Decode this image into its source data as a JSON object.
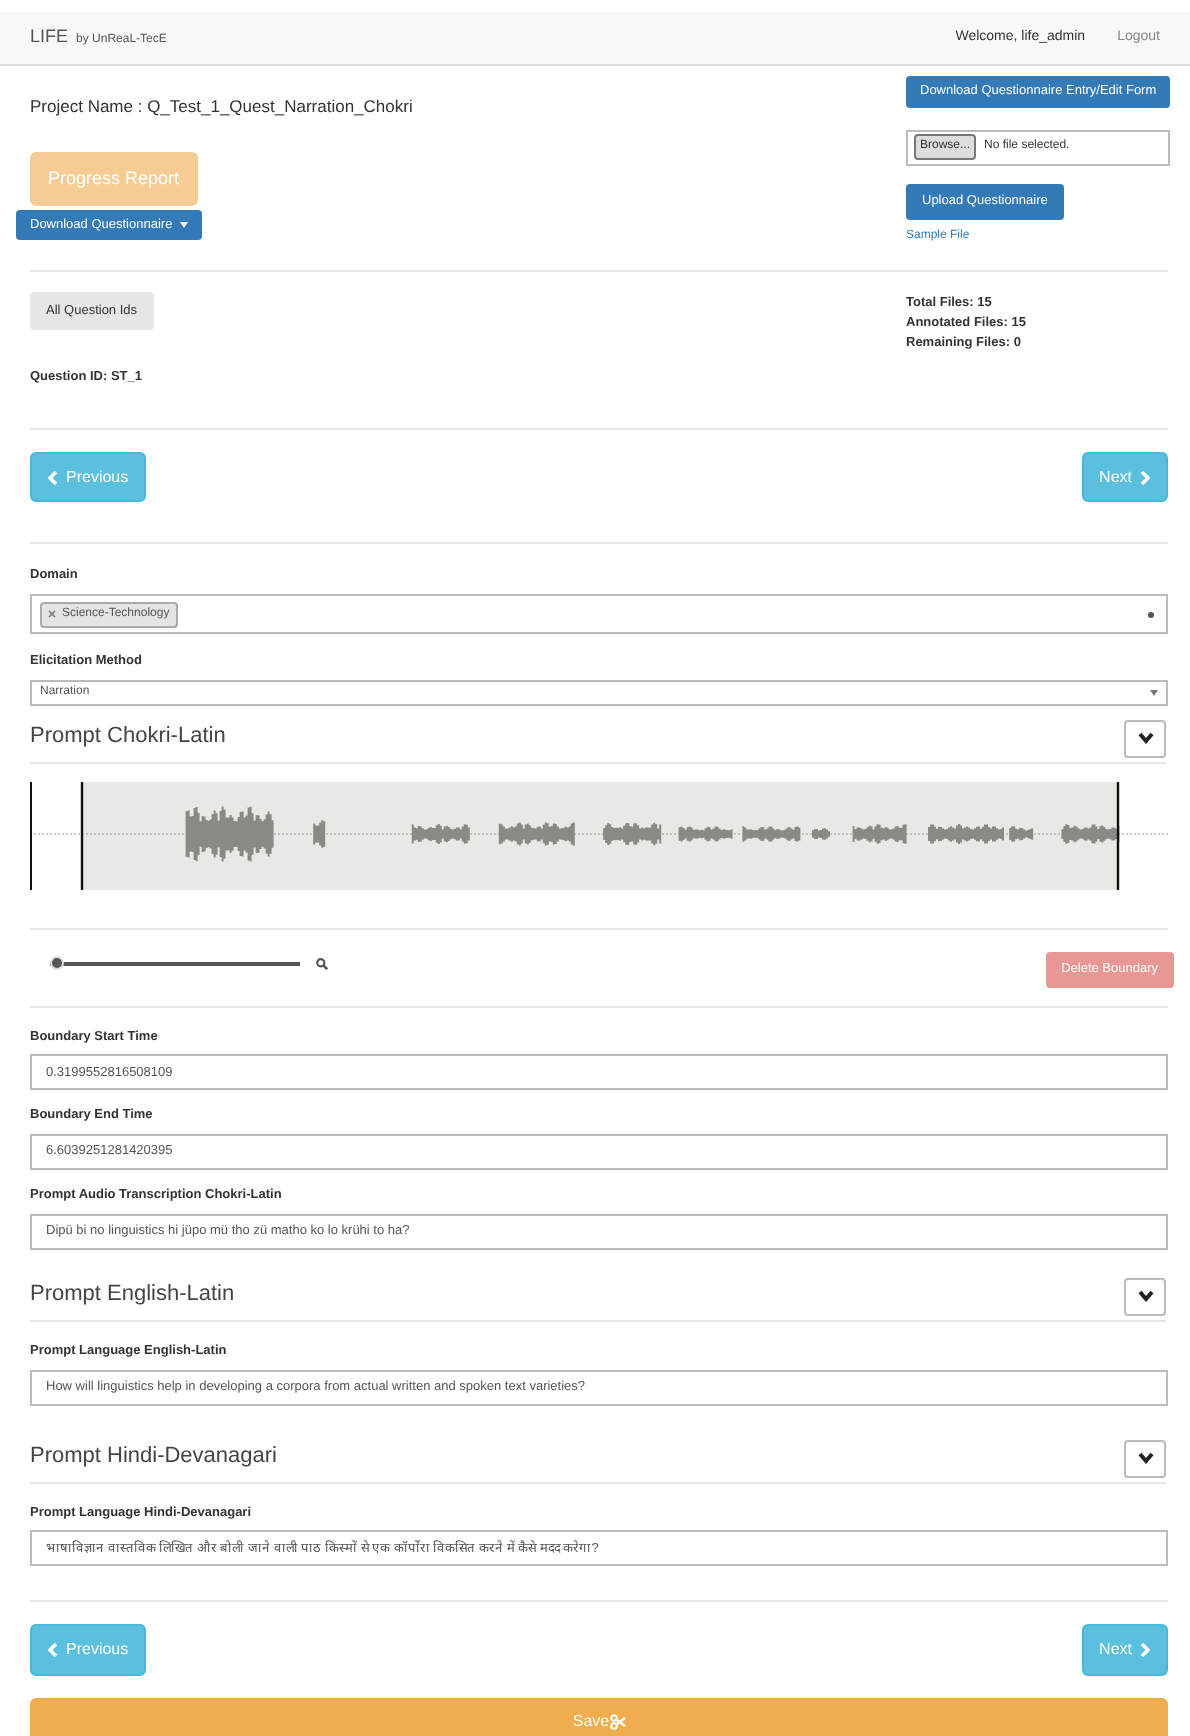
{
  "navbar": {
    "brand": "LIFE",
    "brand_sub": "by UnReaL-TecE",
    "welcome": "Welcome, life_admin",
    "logout": "Logout"
  },
  "project_name": "Project Name : Q_Test_1_Quest_Narration_Chokri",
  "download_form_button": "Download Questionnaire Entry/Edit Form",
  "progress_report_button": {
    "label": "Progress Report",
    "disabled": true
  },
  "file_input": {
    "button": "Browse...",
    "status": "No file selected."
  },
  "download_questionnaire_dropdown": "Download Questionnaire",
  "upload_button": "Upload Questionnaire",
  "sample_file_link": "Sample File",
  "all_question_ids_button": "All Question Ids",
  "stats": [
    "Total Files: 15",
    "Annotated Files: 15",
    "Remaining Files: 0"
  ],
  "question_id": "Question ID: ST_1",
  "nav_top": {
    "previous": "Previous",
    "next": "Next"
  },
  "domain": {
    "label": "Domain",
    "tags": [
      "Science-Technology"
    ]
  },
  "elicitation": {
    "label": "Elicitation Method",
    "value": "Narration"
  },
  "audio_section": {
    "title": "Prompt Chokri-Latin",
    "expanded": true,
    "zoom": {
      "level": 0.0
    },
    "delete_boundary": {
      "label": "Delete Boundary",
      "disabled": true
    }
  },
  "fields": [
    {
      "label": "Boundary Start Time",
      "value": "0.3199552816508109"
    },
    {
      "label": "Boundary End Time",
      "value": "6.6039251281420395"
    },
    {
      "label": "Prompt Audio Transcription Chokri-Latin",
      "value": "Dipü bi no linguistics hi jüpo mü tho zü matho ko lo krühi to ha?"
    }
  ],
  "prompt_sections": [
    {
      "title": "Prompt English-Latin",
      "expanded": true,
      "label": "Prompt Language English-Latin",
      "value": "How will linguistics help in developing a corpora from actual written and spoken text varieties?"
    },
    {
      "title": "Prompt Hindi-Devanagari",
      "expanded": true,
      "label": "Prompt Language Hindi-Devanagari",
      "value": "भाषाविज्ञान वास्तविक लिखित और बोली जाने वाली पाठ किस्मों से एक कॉर्पोरा विकसित करने में कैसे मदद करेगा?"
    }
  ],
  "nav_bottom": {
    "previous": "Previous",
    "next": "Next"
  },
  "save_button": "Save"
}
